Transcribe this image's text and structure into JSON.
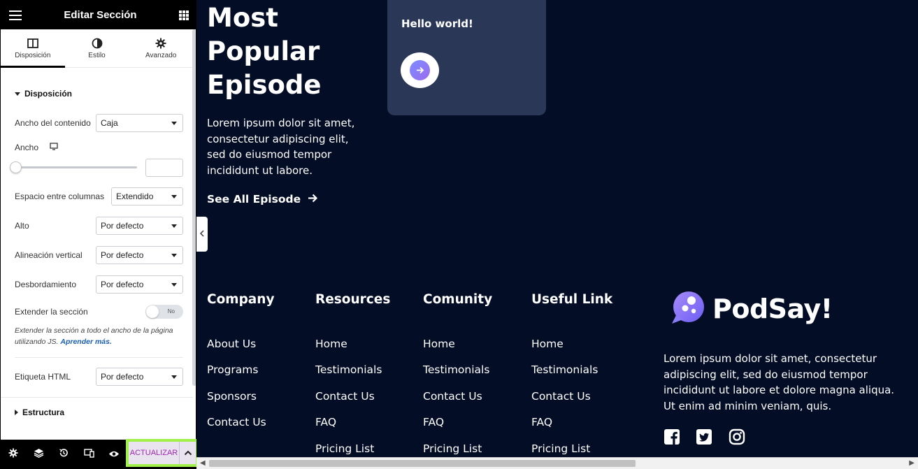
{
  "panel": {
    "title": "Editar Sección",
    "tabs": [
      {
        "label": "Disposición",
        "icon": "columns-icon",
        "active": true
      },
      {
        "label": "Estilo",
        "icon": "contrast-icon",
        "active": false
      },
      {
        "label": "Avanzado",
        "icon": "gear-icon",
        "active": false
      }
    ],
    "section_layout": "Disposición",
    "content_width": {
      "label": "Ancho del contenido",
      "value": "Caja"
    },
    "width": {
      "label": "Ancho",
      "device_icon": "desktop-icon",
      "value": ""
    },
    "column_gap": {
      "label": "Espacio entre columnas",
      "value": "Extendido"
    },
    "height": {
      "label": "Alto",
      "value": "Por defecto"
    },
    "vertical_align": {
      "label": "Alineación vertical",
      "value": "Por defecto"
    },
    "overflow": {
      "label": "Desbordamiento",
      "value": "Por defecto"
    },
    "stretch": {
      "label": "Extender la sección",
      "toggle": "No"
    },
    "stretch_note": "Extender la sección a todo el ancho de la página utilizando JS.",
    "stretch_link": "Aprender más.",
    "html_tag": {
      "label": "Etiqueta HTML",
      "value": "Por defecto"
    },
    "section_structure": "Estructura",
    "update_label": "ACTUALIZAR",
    "colors": {
      "update_bg": "#e9e3ef",
      "update_text": "#9b27af",
      "highlight": "#a2f04a"
    }
  },
  "preview": {
    "hero_title": "Most Popular Episode",
    "hero_text": "Lorem ipsum dolor sit amet, consectetur adipiscing elit, sed do eiusmod tempor incididunt ut labore.",
    "see_all": "See All Episode",
    "card_title": "Hello world!",
    "columns": [
      {
        "title": "Company",
        "links": [
          "About Us",
          "Programs",
          "Sponsors",
          "Contact Us"
        ]
      },
      {
        "title": "Resources",
        "links": [
          "Home",
          "Testimonials",
          "Contact Us",
          "FAQ",
          "Pricing List"
        ]
      },
      {
        "title": "Comunity",
        "links": [
          "Home",
          "Testimonials",
          "Contact Us",
          "FAQ",
          "Pricing List"
        ]
      },
      {
        "title": "Useful Link",
        "links": [
          "Home",
          "Testimonials",
          "Contact Us",
          "FAQ",
          "Pricing List"
        ]
      }
    ],
    "brand_name": "PodSay!",
    "brand_text": "Lorem ipsum dolor sit amet, consectetur adipiscing elit, sed do eiusmod tempor incididunt ut labore et dolore magna aliqua. Ut enim ad minim veniam, quis.",
    "social_icons": [
      "facebook-icon",
      "twitter-icon",
      "instagram-icon"
    ],
    "colors": {
      "background": "#040d26",
      "card": "#2a3757",
      "accent": "#8a7cf6"
    }
  }
}
